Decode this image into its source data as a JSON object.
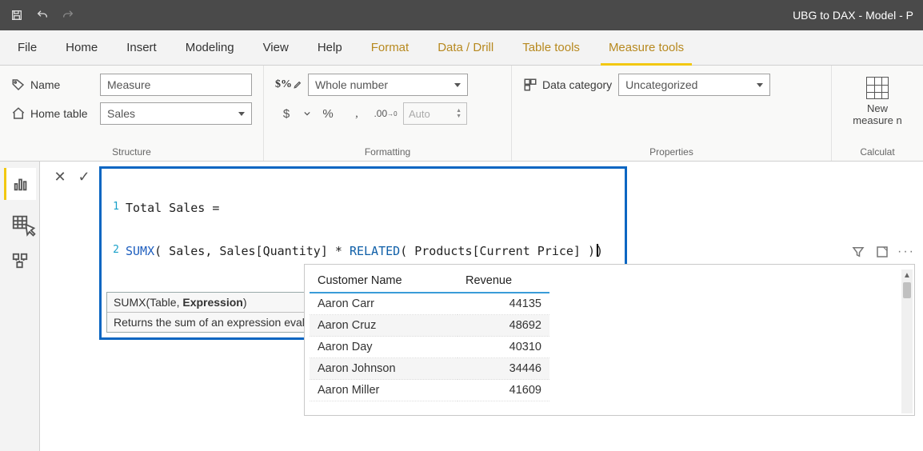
{
  "titlebar": {
    "title": "UBG to DAX - Model - P"
  },
  "tabs": [
    "File",
    "Home",
    "Insert",
    "Modeling",
    "View",
    "Help",
    "Format",
    "Data / Drill",
    "Table tools",
    "Measure tools"
  ],
  "tab_amber_from": 6,
  "tab_active": 9,
  "ribbon": {
    "structure": {
      "label": "Structure",
      "name_label": "Name",
      "name_value": "Measure",
      "home_table_label": "Home table",
      "home_table_value": "Sales"
    },
    "formatting": {
      "label": "Formatting",
      "format_value": "Whole number",
      "auto_placeholder": "Auto"
    },
    "properties": {
      "label": "Properties",
      "data_category_label": "Data category",
      "data_category_value": "Uncategorized"
    },
    "calculations": {
      "label": "Calculat",
      "new_measure_line1": "New",
      "new_measure_line2": "measure  n"
    }
  },
  "formula": {
    "line1": "Total Sales =",
    "fn": "SUMX",
    "args1": "( Sales, Sales[Quantity] * ",
    "rel": "RELATED",
    "args2": "( Products[Current Price] )",
    "intelli_sig_prefix": "SUMX(Table, ",
    "intelli_sig_bold": "Expression",
    "intelli_sig_suffix": ")",
    "intelli_desc": "Returns the sum of an expression evaluated for each row in a table."
  },
  "table": {
    "headers": [
      "Customer Name",
      "Revenue"
    ],
    "rows": [
      [
        "Aaron Carr",
        "44135"
      ],
      [
        "Aaron Cruz",
        "48692"
      ],
      [
        "Aaron Day",
        "40310"
      ],
      [
        "Aaron Johnson",
        "34446"
      ],
      [
        "Aaron Miller",
        "41609"
      ]
    ]
  }
}
